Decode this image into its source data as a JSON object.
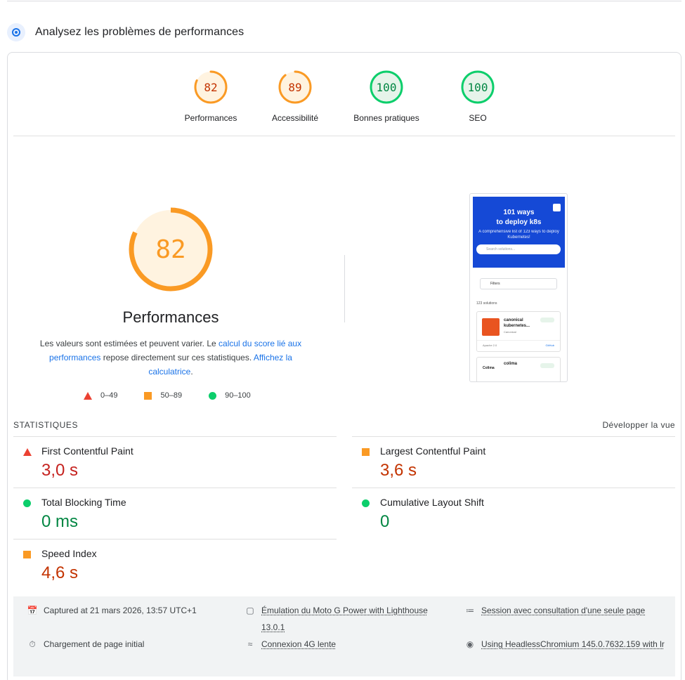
{
  "section": {
    "title": "Analysez les problèmes de performances"
  },
  "scores": [
    {
      "label": "Performances",
      "value": "82",
      "color": "#fa9a24",
      "level": 0.82,
      "rating": "average"
    },
    {
      "label": "Accessibilité",
      "value": "89",
      "color": "#fa9a24",
      "level": 0.89,
      "rating": "average"
    },
    {
      "label": "Bonnes pratiques",
      "value": "100",
      "color": "#0cce6b",
      "level": 1.0,
      "rating": "pass"
    },
    {
      "label": "SEO",
      "value": "100",
      "color": "#0cce6b",
      "level": 1.0,
      "rating": "pass"
    }
  ],
  "main": {
    "score": "82",
    "level": 0.82,
    "title": "Performances",
    "desc_prefix": "Les valeurs sont estimées et peuvent varier. Le ",
    "desc_link1": "calcul du score lié aux performances",
    "desc_middle": " repose directement sur ces statistiques. ",
    "desc_link2": "Affichez la calculatrice",
    "desc_suffix": "."
  },
  "legend": [
    {
      "shape": "triangle-icon",
      "label": "0–49",
      "color": "#eb4132"
    },
    {
      "shape": "square-icon",
      "label": "50–89",
      "color": "#fa9a24"
    },
    {
      "shape": "circle-icon",
      "label": "90–100",
      "color": "#0cce6b"
    }
  ],
  "thumbnail": {
    "title_line1": "101 ways",
    "title_line2": "to deploy k8s",
    "subtitle": "A comprehensive list of 123 ways to deploy Kubernetes!",
    "search_placeholder": "Search solutions...",
    "filters": "Filters",
    "count": "123 solutions",
    "card1_name": "canonical kubernetes...",
    "card1_sub": "Canonical",
    "card1_license": "Apache 2.0",
    "card1_link": "GitHub",
    "card2_name": "colima",
    "card2_logo": "Colima"
  },
  "metrics": {
    "title": "STATISTIQUES",
    "toggle": "Développer la vue",
    "items": [
      {
        "name": "First Contentful Paint",
        "value": "3,0 s",
        "rating": "fail",
        "icon": "triangle-icon"
      },
      {
        "name": "Largest Contentful Paint",
        "value": "3,6 s",
        "rating": "average",
        "icon": "square-icon"
      },
      {
        "name": "Total Blocking Time",
        "value": "0 ms",
        "rating": "pass",
        "icon": "circle-icon"
      },
      {
        "name": "Cumulative Layout Shift",
        "value": "0",
        "rating": "pass",
        "icon": "circle-icon"
      },
      {
        "name": "Speed Index",
        "value": "4,6 s",
        "rating": "average",
        "icon": "square-icon"
      }
    ]
  },
  "environment": {
    "captured": "Captured at 21 mars 2026, 13:57 UTC+1",
    "emulation": "Émulation du Moto G Power with Lighthouse 13.0.1",
    "session": "Session avec consultation d'une seule page",
    "load": "Chargement de page initial",
    "network": "Connexion 4G lente",
    "browser": "Using HeadlessChromium 145.0.7632.159 with lr"
  }
}
